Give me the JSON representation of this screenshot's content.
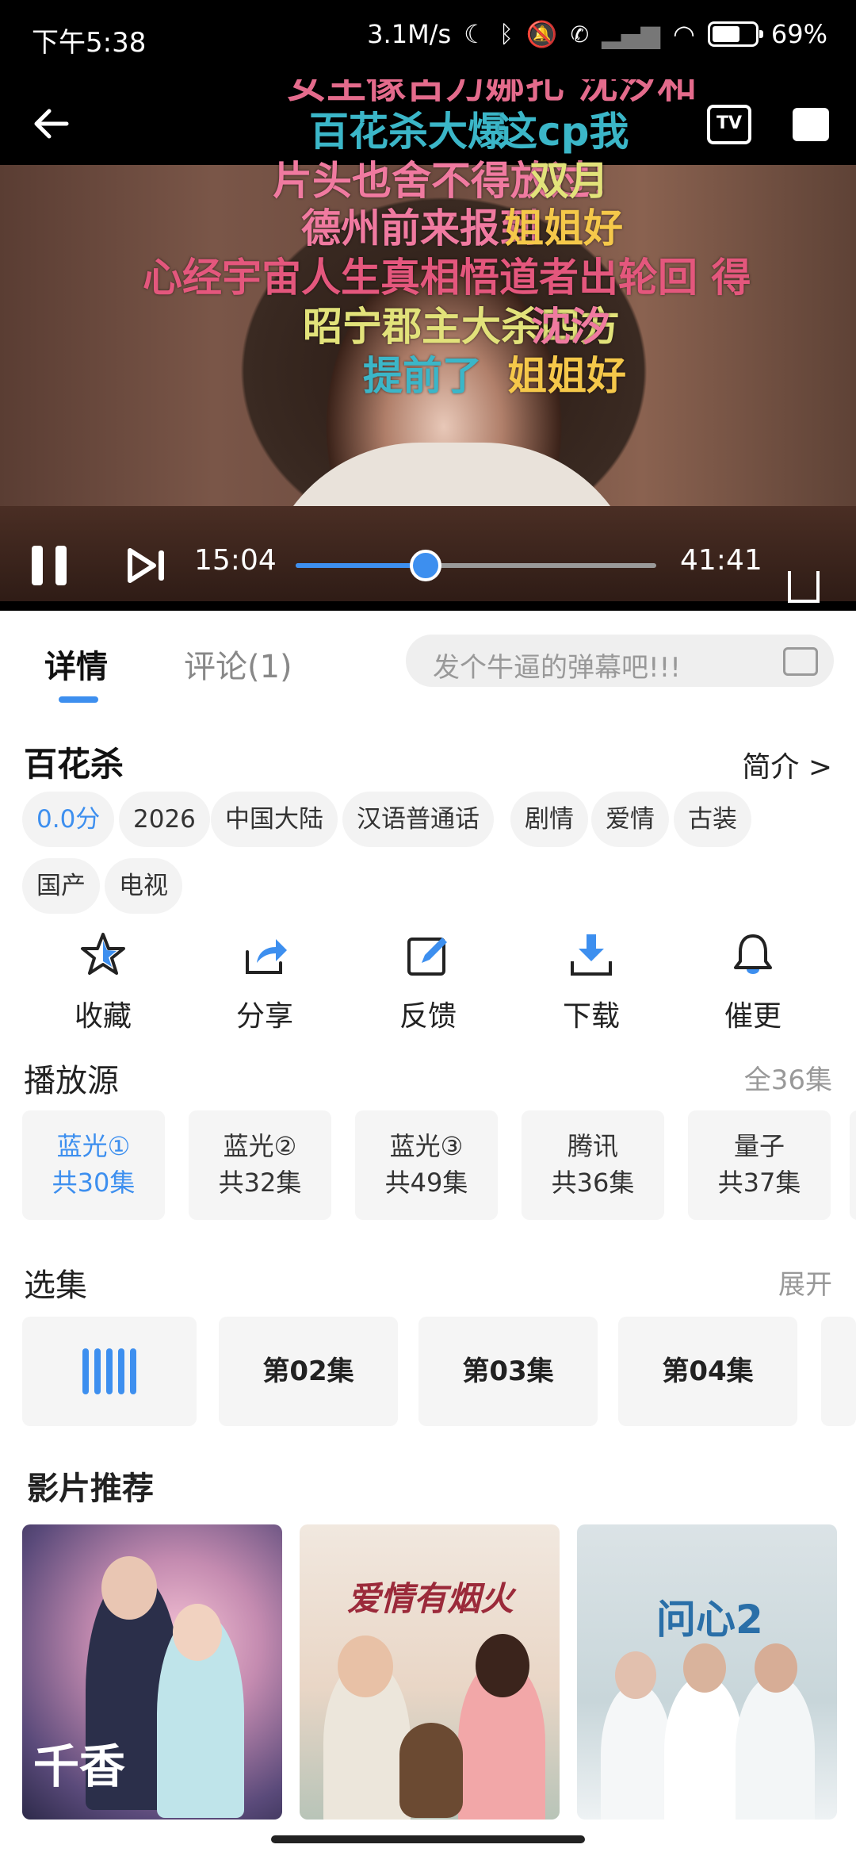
{
  "status_bar": {
    "time": "下午5:38",
    "speed": "3.1M/s",
    "battery": "69%",
    "battery_level": 0.69
  },
  "player": {
    "danmu": [
      {
        "text": "女主像古力娜扎 沈汐和",
        "color": "#e46b8c"
      },
      {
        "text": "百花杀大爆",
        "color": "#3bb6c8"
      },
      {
        "text": "这cp我",
        "color": "#3bb6c8"
      },
      {
        "text": "片头也舍不得放过！",
        "color": "#f07aa0"
      },
      {
        "text": "双月",
        "color": "#e2e27a"
      },
      {
        "text": "德州前来报到",
        "color": "#f07aa0"
      },
      {
        "text": "姐姐好",
        "color": "#f5c84a"
      },
      {
        "text": "心经宇宙人生真相悟道者出轮回 得",
        "color": "#e4577d"
      },
      {
        "text": "昭宁郡主大杀四方",
        "color": "#e2e27a"
      },
      {
        "text": "沈汐",
        "color": "#f07aa0"
      },
      {
        "text": "提前了",
        "color": "#3bb6c8"
      },
      {
        "text": "姐姐好",
        "color": "#f5c84a"
      }
    ],
    "current_time": "15:04",
    "total_time": "41:41",
    "progress": 0.3612,
    "tv_label": "TV"
  },
  "tabs": {
    "details": "详情",
    "comments": "评论(1)",
    "danmu_placeholder": "发个牛逼的弹幕吧!!!"
  },
  "show": {
    "title": "百花杀",
    "intro_link": "简介 >",
    "tags": [
      "0.0分",
      "2026",
      "中国大陆",
      "汉语普通话",
      "剧情",
      "爱情",
      "古装",
      "国产",
      "电视"
    ]
  },
  "actions": [
    {
      "label": "收藏",
      "icon": "star-icon"
    },
    {
      "label": "分享",
      "icon": "share-icon"
    },
    {
      "label": "反馈",
      "icon": "edit-icon"
    },
    {
      "label": "下载",
      "icon": "download-icon"
    },
    {
      "label": "催更",
      "icon": "bell-icon"
    }
  ],
  "sources": {
    "title": "播放源",
    "total": "全36集",
    "items": [
      {
        "name": "蓝光①",
        "count": "共30集"
      },
      {
        "name": "蓝光②",
        "count": "共32集"
      },
      {
        "name": "蓝光③",
        "count": "共49集"
      },
      {
        "name": "腾讯",
        "count": "共36集"
      },
      {
        "name": "量子",
        "count": "共37集"
      }
    ]
  },
  "episodes": {
    "title": "选集",
    "expand": "展开",
    "items": [
      "第02集",
      "第03集",
      "第04集"
    ]
  },
  "recommend": {
    "title": "影片推荐",
    "posters": [
      {
        "text": "千香"
      },
      {
        "text": "爱情有烟火"
      },
      {
        "text": "问心2"
      }
    ]
  },
  "colors": {
    "accent": "#3d8fef"
  }
}
